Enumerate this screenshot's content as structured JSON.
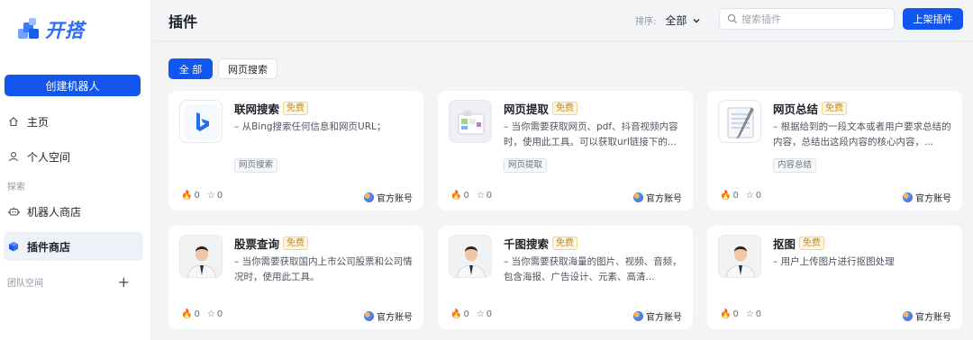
{
  "brand": {
    "logo_text": "开搭",
    "accent": "#1256f0"
  },
  "sidebar": {
    "create_label": "创建机器人",
    "items": [
      {
        "label": "主页",
        "icon": "home-icon"
      },
      {
        "label": "个人空间",
        "icon": "user-icon"
      }
    ],
    "section_explore": "探索",
    "explore_items": [
      {
        "label": "机器人商店",
        "icon": "robot-icon"
      },
      {
        "label": "插件商店",
        "icon": "cube-icon",
        "active": true
      }
    ],
    "team_label": "团队空间",
    "team_add": "+"
  },
  "header": {
    "title": "插件",
    "sort_label": "排序:",
    "sort_value": "全部",
    "search_placeholder": "搜索插件",
    "publish_label": "上架插件"
  },
  "filters": {
    "all": "全 部",
    "web_search": "网页搜索"
  },
  "cards": [
    {
      "name": "联网搜索",
      "badge": "免费",
      "desc": "– 从Bing搜索任何信息和网页URL；",
      "tag": "网页搜索",
      "likes": "0",
      "stars": "0",
      "owner": "官方账号",
      "icon": "bing-icon"
    },
    {
      "name": "网页提取",
      "badge": "免费",
      "desc": "– 当你需要获取网页、pdf、抖音视频内容时，使用此工具。可以获取url链接下的...",
      "tag": "网页提取",
      "likes": "0",
      "stars": "0",
      "owner": "官方账号",
      "icon": "web-extract-icon"
    },
    {
      "name": "网页总结",
      "badge": "免费",
      "desc": "– 根据给到的一段文本或者用户要求总结的内容，总结出这段内容的核心内容，...",
      "tag": "内容总结",
      "likes": "0",
      "stars": "0",
      "owner": "官方账号",
      "icon": "notepad-icon"
    },
    {
      "name": "股票查询",
      "badge": "免费",
      "desc": "– 当你需要获取国内上市公司股票和公司情况时，使用此工具。",
      "tag": "",
      "likes": "0",
      "stars": "0",
      "owner": "官方账号",
      "icon": "avatar-icon"
    },
    {
      "name": "千图搜索",
      "badge": "免费",
      "desc": "– 当你需要获取海量的图片、视频、音频，包含海报、广告设计、元素、高清...",
      "tag": "",
      "likes": "0",
      "stars": "0",
      "owner": "官方账号",
      "icon": "avatar-icon"
    },
    {
      "name": "抠图",
      "badge": "免费",
      "desc": "– 用户上传图片进行抠图处理",
      "tag": "",
      "likes": "0",
      "stars": "0",
      "owner": "官方账号",
      "icon": "avatar-icon"
    }
  ]
}
